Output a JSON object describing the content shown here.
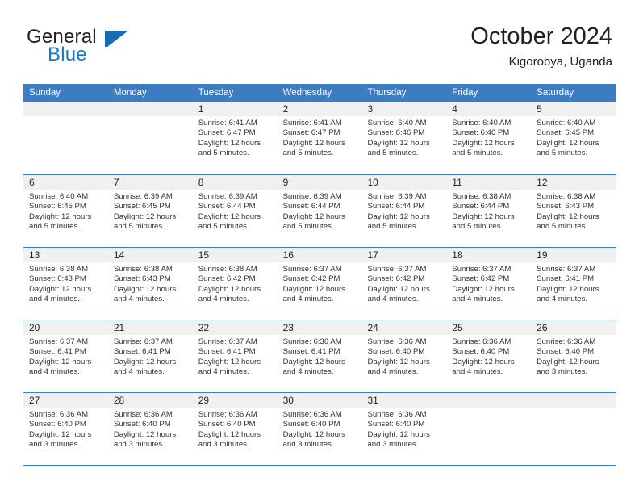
{
  "brand": {
    "name_part1": "General",
    "name_part2": "Blue",
    "accent_color": "#1c6bb0"
  },
  "header": {
    "title": "October 2024",
    "subtitle": "Kigorobya, Uganda"
  },
  "calendar": {
    "header_color": "#3b7dc0",
    "weekdays": [
      "Sunday",
      "Monday",
      "Tuesday",
      "Wednesday",
      "Thursday",
      "Friday",
      "Saturday"
    ],
    "weeks": [
      [
        {
          "day": "",
          "sunrise": "",
          "sunset": "",
          "daylight": "",
          "empty": true
        },
        {
          "day": "",
          "sunrise": "",
          "sunset": "",
          "daylight": "",
          "empty": true
        },
        {
          "day": "1",
          "sunrise": "Sunrise: 6:41 AM",
          "sunset": "Sunset: 6:47 PM",
          "daylight": "Daylight: 12 hours and 5 minutes."
        },
        {
          "day": "2",
          "sunrise": "Sunrise: 6:41 AM",
          "sunset": "Sunset: 6:47 PM",
          "daylight": "Daylight: 12 hours and 5 minutes."
        },
        {
          "day": "3",
          "sunrise": "Sunrise: 6:40 AM",
          "sunset": "Sunset: 6:46 PM",
          "daylight": "Daylight: 12 hours and 5 minutes."
        },
        {
          "day": "4",
          "sunrise": "Sunrise: 6:40 AM",
          "sunset": "Sunset: 6:46 PM",
          "daylight": "Daylight: 12 hours and 5 minutes."
        },
        {
          "day": "5",
          "sunrise": "Sunrise: 6:40 AM",
          "sunset": "Sunset: 6:45 PM",
          "daylight": "Daylight: 12 hours and 5 minutes."
        }
      ],
      [
        {
          "day": "6",
          "sunrise": "Sunrise: 6:40 AM",
          "sunset": "Sunset: 6:45 PM",
          "daylight": "Daylight: 12 hours and 5 minutes."
        },
        {
          "day": "7",
          "sunrise": "Sunrise: 6:39 AM",
          "sunset": "Sunset: 6:45 PM",
          "daylight": "Daylight: 12 hours and 5 minutes."
        },
        {
          "day": "8",
          "sunrise": "Sunrise: 6:39 AM",
          "sunset": "Sunset: 6:44 PM",
          "daylight": "Daylight: 12 hours and 5 minutes."
        },
        {
          "day": "9",
          "sunrise": "Sunrise: 6:39 AM",
          "sunset": "Sunset: 6:44 PM",
          "daylight": "Daylight: 12 hours and 5 minutes."
        },
        {
          "day": "10",
          "sunrise": "Sunrise: 6:39 AM",
          "sunset": "Sunset: 6:44 PM",
          "daylight": "Daylight: 12 hours and 5 minutes."
        },
        {
          "day": "11",
          "sunrise": "Sunrise: 6:38 AM",
          "sunset": "Sunset: 6:44 PM",
          "daylight": "Daylight: 12 hours and 5 minutes."
        },
        {
          "day": "12",
          "sunrise": "Sunrise: 6:38 AM",
          "sunset": "Sunset: 6:43 PM",
          "daylight": "Daylight: 12 hours and 5 minutes."
        }
      ],
      [
        {
          "day": "13",
          "sunrise": "Sunrise: 6:38 AM",
          "sunset": "Sunset: 6:43 PM",
          "daylight": "Daylight: 12 hours and 4 minutes."
        },
        {
          "day": "14",
          "sunrise": "Sunrise: 6:38 AM",
          "sunset": "Sunset: 6:43 PM",
          "daylight": "Daylight: 12 hours and 4 minutes."
        },
        {
          "day": "15",
          "sunrise": "Sunrise: 6:38 AM",
          "sunset": "Sunset: 6:42 PM",
          "daylight": "Daylight: 12 hours and 4 minutes."
        },
        {
          "day": "16",
          "sunrise": "Sunrise: 6:37 AM",
          "sunset": "Sunset: 6:42 PM",
          "daylight": "Daylight: 12 hours and 4 minutes."
        },
        {
          "day": "17",
          "sunrise": "Sunrise: 6:37 AM",
          "sunset": "Sunset: 6:42 PM",
          "daylight": "Daylight: 12 hours and 4 minutes."
        },
        {
          "day": "18",
          "sunrise": "Sunrise: 6:37 AM",
          "sunset": "Sunset: 6:42 PM",
          "daylight": "Daylight: 12 hours and 4 minutes."
        },
        {
          "day": "19",
          "sunrise": "Sunrise: 6:37 AM",
          "sunset": "Sunset: 6:41 PM",
          "daylight": "Daylight: 12 hours and 4 minutes."
        }
      ],
      [
        {
          "day": "20",
          "sunrise": "Sunrise: 6:37 AM",
          "sunset": "Sunset: 6:41 PM",
          "daylight": "Daylight: 12 hours and 4 minutes."
        },
        {
          "day": "21",
          "sunrise": "Sunrise: 6:37 AM",
          "sunset": "Sunset: 6:41 PM",
          "daylight": "Daylight: 12 hours and 4 minutes."
        },
        {
          "day": "22",
          "sunrise": "Sunrise: 6:37 AM",
          "sunset": "Sunset: 6:41 PM",
          "daylight": "Daylight: 12 hours and 4 minutes."
        },
        {
          "day": "23",
          "sunrise": "Sunrise: 6:36 AM",
          "sunset": "Sunset: 6:41 PM",
          "daylight": "Daylight: 12 hours and 4 minutes."
        },
        {
          "day": "24",
          "sunrise": "Sunrise: 6:36 AM",
          "sunset": "Sunset: 6:40 PM",
          "daylight": "Daylight: 12 hours and 4 minutes."
        },
        {
          "day": "25",
          "sunrise": "Sunrise: 6:36 AM",
          "sunset": "Sunset: 6:40 PM",
          "daylight": "Daylight: 12 hours and 4 minutes."
        },
        {
          "day": "26",
          "sunrise": "Sunrise: 6:36 AM",
          "sunset": "Sunset: 6:40 PM",
          "daylight": "Daylight: 12 hours and 3 minutes."
        }
      ],
      [
        {
          "day": "27",
          "sunrise": "Sunrise: 6:36 AM",
          "sunset": "Sunset: 6:40 PM",
          "daylight": "Daylight: 12 hours and 3 minutes."
        },
        {
          "day": "28",
          "sunrise": "Sunrise: 6:36 AM",
          "sunset": "Sunset: 6:40 PM",
          "daylight": "Daylight: 12 hours and 3 minutes."
        },
        {
          "day": "29",
          "sunrise": "Sunrise: 6:36 AM",
          "sunset": "Sunset: 6:40 PM",
          "daylight": "Daylight: 12 hours and 3 minutes."
        },
        {
          "day": "30",
          "sunrise": "Sunrise: 6:36 AM",
          "sunset": "Sunset: 6:40 PM",
          "daylight": "Daylight: 12 hours and 3 minutes."
        },
        {
          "day": "31",
          "sunrise": "Sunrise: 6:36 AM",
          "sunset": "Sunset: 6:40 PM",
          "daylight": "Daylight: 12 hours and 3 minutes."
        },
        {
          "day": "",
          "sunrise": "",
          "sunset": "",
          "daylight": "",
          "empty": true
        },
        {
          "day": "",
          "sunrise": "",
          "sunset": "",
          "daylight": "",
          "empty": true
        }
      ]
    ]
  }
}
